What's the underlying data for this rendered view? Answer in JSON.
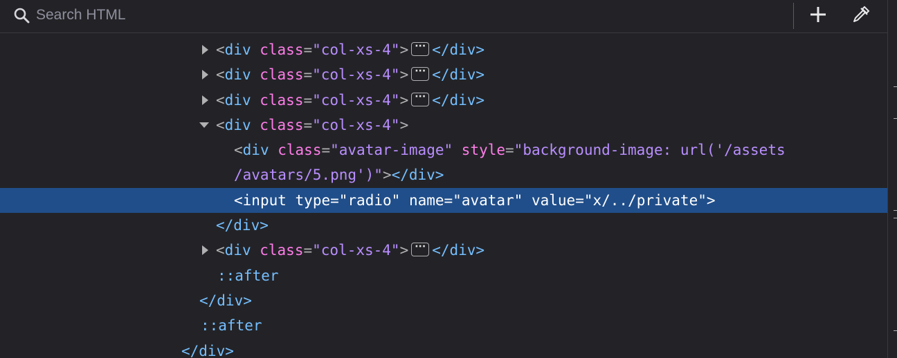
{
  "search": {
    "placeholder": "Search HTML"
  },
  "toolbar": {
    "add_icon": "plus-icon",
    "picker_icon": "eyedropper-icon"
  },
  "icons": {
    "search": "search-icon",
    "expand": "triangle-right-icon",
    "collapse": "triangle-down-icon",
    "ellipsis": "ellipsis-icon"
  },
  "colors": {
    "background": "#232327",
    "selection": "#204e8a",
    "tag": "#75bfff",
    "attribute": "#ff7de9",
    "value": "#b98eff"
  },
  "tree": {
    "r0": {
      "open": "<",
      "tag": "div",
      "attr": "class",
      "eq": "=",
      "val": "\"col-xs-4\"",
      "close": ">",
      "end": "</div>"
    },
    "r1": {
      "open": "<",
      "tag": "div",
      "attr": "class",
      "eq": "=",
      "val": "\"col-xs-4\"",
      "close": ">",
      "end": "</div>"
    },
    "r2": {
      "open": "<",
      "tag": "div",
      "attr": "class",
      "eq": "=",
      "val": "\"col-xs-4\"",
      "close": ">",
      "end": "</div>"
    },
    "r3": {
      "open": "<",
      "tag": "div",
      "attr": "class",
      "eq": "=",
      "val": "\"col-xs-4\"",
      "close": ">"
    },
    "r4": {
      "open": "<",
      "tag": "div",
      "attr1": "class",
      "eq1": "=",
      "val1": "\"avatar-image\"",
      "attr2": "style",
      "eq2": "=",
      "val2a": "\"background-image: url('/assets",
      "val2b": "/avatars/5.png')\"",
      "close": ">",
      "end": "</div>"
    },
    "r5": {
      "open": "<",
      "tag": "input",
      "attr1": "type",
      "eq1": "=",
      "val1": "\"radio\"",
      "attr2": "name",
      "eq2": "=",
      "val2": "\"avatar\"",
      "attr3": "value",
      "eq3": "=",
      "val3": "\"x/../private\"",
      "close": ">"
    },
    "r6": {
      "end": "</div>"
    },
    "r7": {
      "open": "<",
      "tag": "div",
      "attr": "class",
      "eq": "=",
      "val": "\"col-xs-4\"",
      "close": ">",
      "end": "</div>"
    },
    "r8": {
      "pseudo": "::after"
    },
    "r9": {
      "end": "</div>"
    },
    "r10": {
      "pseudo": "::after"
    },
    "r11": {
      "end": "</div>"
    }
  },
  "ellipsis_text": "···"
}
